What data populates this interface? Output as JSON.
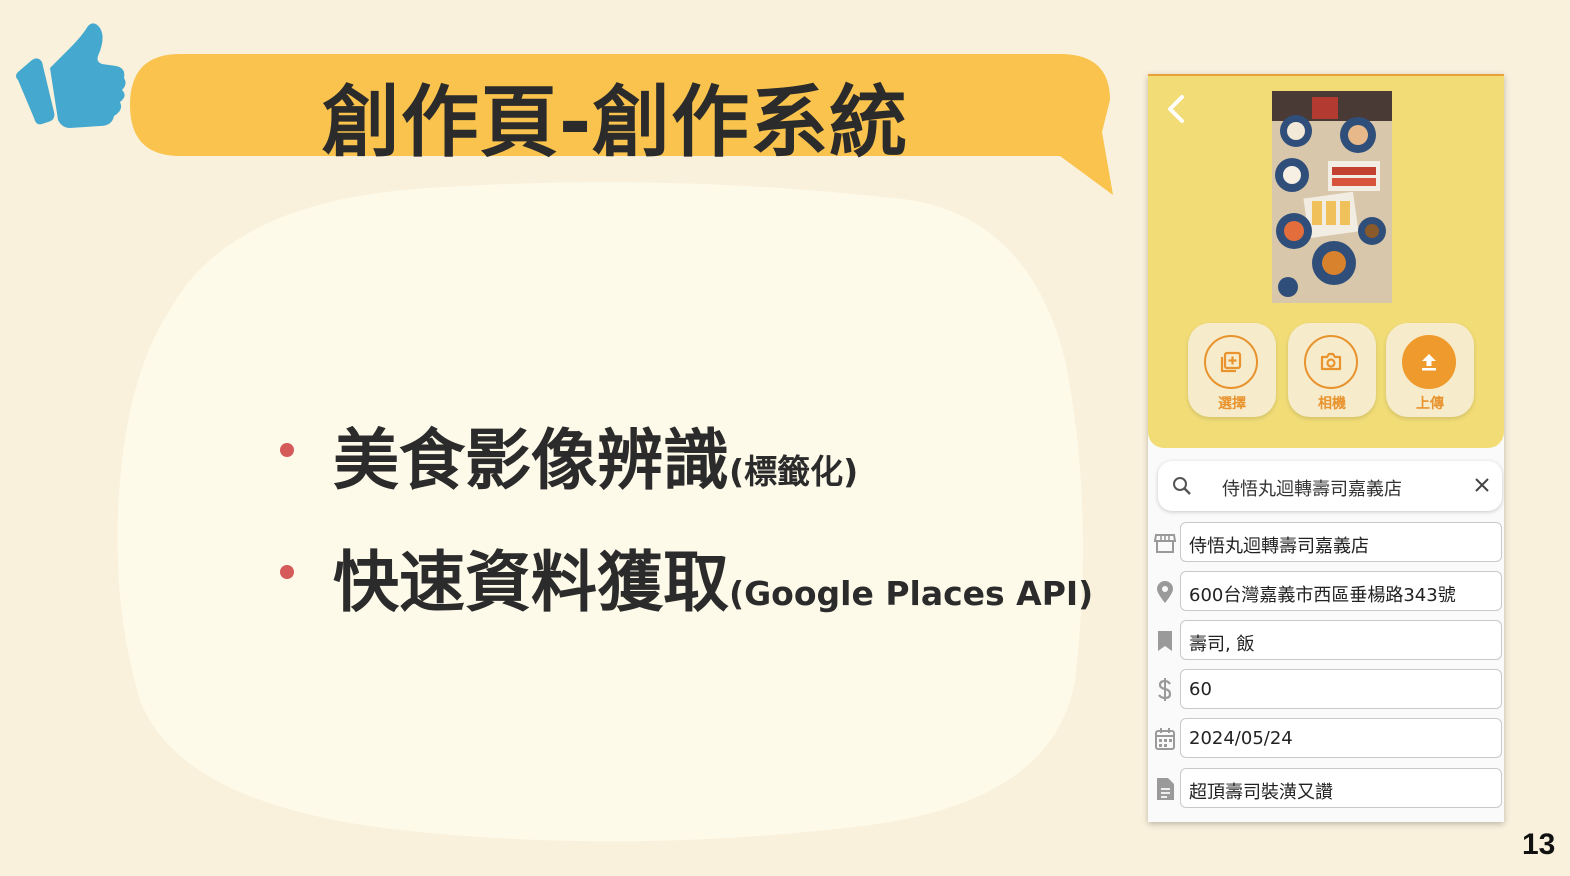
{
  "slide": {
    "title": "創作頁-創作系統",
    "page_number": "13",
    "bullets": [
      {
        "main": "美食影像辨識",
        "sub": "(標籤化)"
      },
      {
        "main": "快速資料獲取",
        "sub": "(Google Places API)"
      }
    ]
  },
  "phone": {
    "actions": [
      {
        "label": "選擇",
        "icon": "add-photo-icon"
      },
      {
        "label": "相機",
        "icon": "camera-icon"
      },
      {
        "label": "上傳",
        "icon": "upload-icon"
      }
    ],
    "search": {
      "value": "侍悟丸迴轉壽司嘉義店"
    },
    "fields": {
      "store": "侍悟丸迴轉壽司嘉義店",
      "address": "600台灣嘉義市西區垂楊路343號",
      "tags": "壽司, 飯",
      "price": "60",
      "date": "2024/05/24",
      "note": "超頂壽司裝潢又讚"
    }
  },
  "colors": {
    "background": "#f9f1dc",
    "banner": "#f9c34d",
    "thumb": "#45a9cf",
    "accent": "#ef9a2c",
    "bullet_dot": "#d55a5a"
  }
}
